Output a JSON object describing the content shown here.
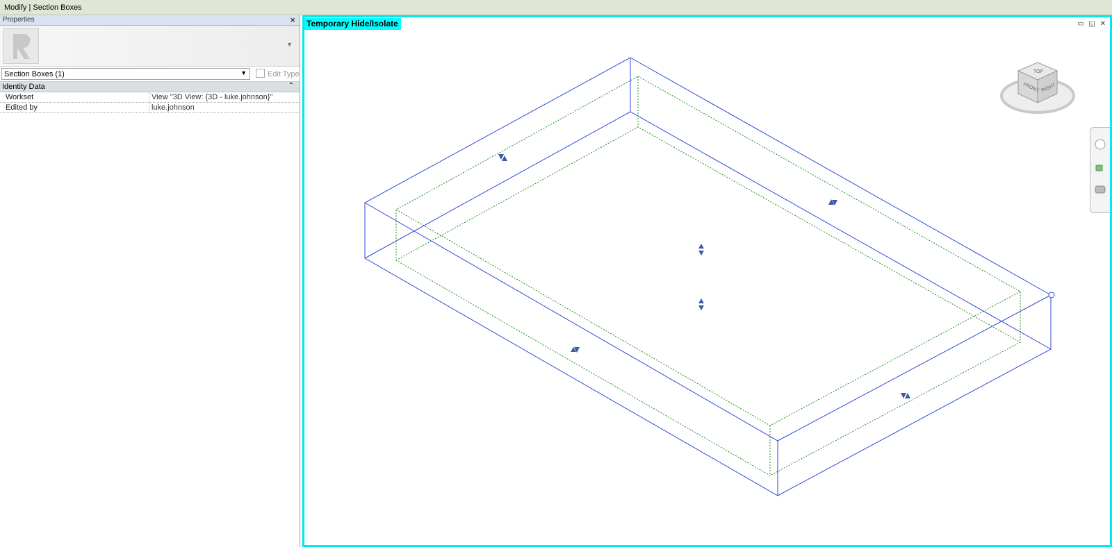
{
  "window": {
    "title": "Modify | Section Boxes"
  },
  "properties": {
    "header": "Properties",
    "type_selector": "Section Boxes (1)",
    "edit_type": "Edit Type",
    "group": "Identity Data",
    "rows": [
      {
        "key": "Workset",
        "value": "View \"3D View: {3D - luke.johnson}\""
      },
      {
        "key": "Edited by",
        "value": "luke.johnson"
      }
    ]
  },
  "viewport": {
    "badge": "Temporary Hide/Isolate",
    "viewcube": {
      "top": "TOP",
      "front": "FRONT",
      "right": "RIGHT"
    },
    "colors": {
      "section_box": "#2c47d8",
      "hidden_bounds": "#1f8a1f",
      "highlight": "#00ffff"
    }
  }
}
